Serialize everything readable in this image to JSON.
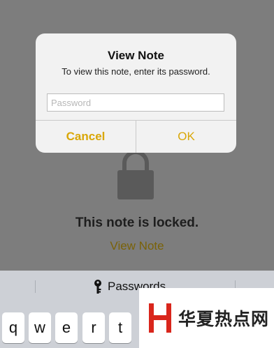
{
  "alert": {
    "title": "View Note",
    "message": "To view this note, enter its password.",
    "password_placeholder": "Password",
    "password_value": "",
    "cancel_label": "Cancel",
    "ok_label": "OK"
  },
  "note": {
    "locked_text": "This note is locked.",
    "view_note_label": "View Note"
  },
  "keyboard": {
    "suggestion": "Passwords",
    "keys": [
      "q",
      "w",
      "e",
      "r",
      "t"
    ]
  },
  "watermark": {
    "text": "华夏热点网"
  },
  "colors": {
    "accent": "#d9a707",
    "link_dimmed": "#7a6208",
    "overlay_bg": "#7d7d7d",
    "keyboard_bg": "#cdd0d6",
    "watermark_red": "#d9261c"
  }
}
